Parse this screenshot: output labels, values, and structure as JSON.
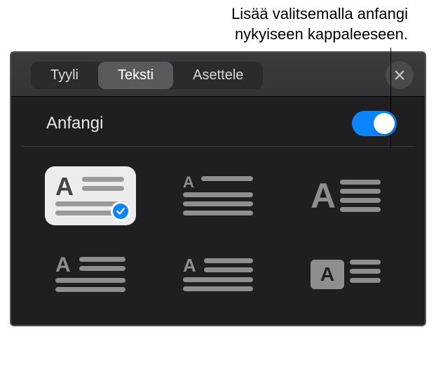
{
  "caption": {
    "line1": "Lisää valitsemalla anfangi",
    "line2": "nykyiseen kappaleeseen."
  },
  "tabs": {
    "style": "Tyyli",
    "text": "Teksti",
    "layout": "Asettele"
  },
  "section": {
    "title": "Anfangi",
    "toggle_on": true
  },
  "options": [
    {
      "id": "dropcap-style-1",
      "selected": true
    },
    {
      "id": "dropcap-style-2",
      "selected": false
    },
    {
      "id": "dropcap-style-3",
      "selected": false
    },
    {
      "id": "dropcap-style-4",
      "selected": false
    },
    {
      "id": "dropcap-style-5",
      "selected": false
    },
    {
      "id": "dropcap-style-6",
      "selected": false
    }
  ]
}
